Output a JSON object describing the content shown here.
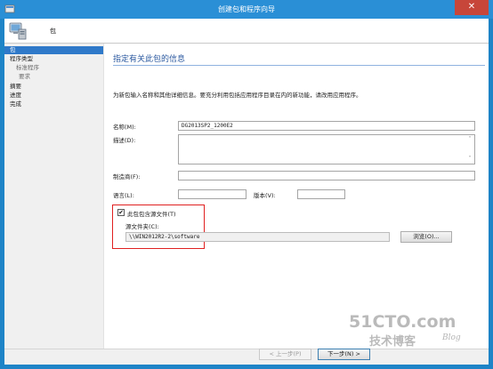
{
  "window": {
    "title": "创建包和程序向导",
    "close_glyph": "✕"
  },
  "header": {
    "title": "包"
  },
  "nav": {
    "items": [
      {
        "label": "包",
        "level": "top",
        "selected": true
      },
      {
        "label": "程序类型",
        "level": "top",
        "selected": false
      },
      {
        "label": "标准程序",
        "level": "sub1",
        "selected": false
      },
      {
        "label": "要求",
        "level": "sub2",
        "selected": false
      },
      {
        "label": "摘要",
        "level": "top",
        "selected": false
      },
      {
        "label": "进度",
        "level": "top",
        "selected": false
      },
      {
        "label": "完成",
        "level": "top",
        "selected": false
      }
    ]
  },
  "main": {
    "page_title": "指定有关此包的信息",
    "instructions": "为新包输入名称和其他详细信息。要充分利用包括应用程序目录在内的新功能，请改用应用程序。",
    "name_label": "名称(M):",
    "name_value": "DG2013SP2_1200E2",
    "description_label": "描述(D):",
    "description_value": "",
    "manufacturer_label": "制造商(F):",
    "manufacturer_value": "",
    "language_label": "语言(L):",
    "language_value": "",
    "version_label": "版本(V):",
    "version_value": "",
    "contains_source_label": "此包包含源文件(T)",
    "contains_source_checked": true,
    "source_folder_label": "源文件夹(C):",
    "source_folder_value": "\\\\WIN2012R2-2\\software",
    "browse_label": "浏览(O)...",
    "scroll_up_glyph": "˄",
    "scroll_down_glyph": "˅",
    "check_glyph": "✔"
  },
  "footer": {
    "prev_label": "< 上一步(P)",
    "next_label": "下一步(N) >"
  },
  "watermark": {
    "main": "51CTO.com",
    "sub": "技术博客",
    "blog": "Blog"
  },
  "colors": {
    "titlebar": "#2a8fd6",
    "nav_selected": "#2f79c9",
    "page_title": "#2c5aa0",
    "highlight_box": "#e02020"
  }
}
